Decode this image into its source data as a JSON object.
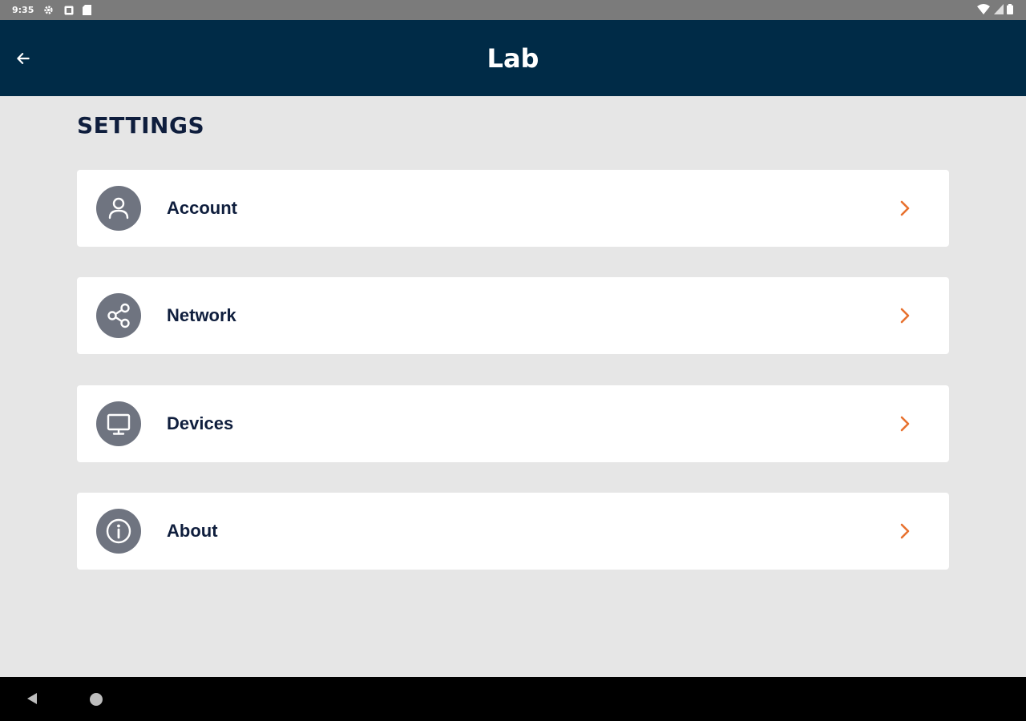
{
  "status_bar": {
    "time": "9:35",
    "icons": [
      "settings-icon",
      "notification-icon",
      "sd-card-icon"
    ],
    "right_icons": [
      "wifi-icon",
      "signal-icon",
      "battery-icon"
    ]
  },
  "app_bar": {
    "title": "Lab",
    "back_icon": "arrow-left-icon"
  },
  "section": {
    "title": "SETTINGS"
  },
  "settings_items": [
    {
      "label": "Account",
      "icon": "user-icon"
    },
    {
      "label": "Network",
      "icon": "share-icon"
    },
    {
      "label": "Devices",
      "icon": "monitor-icon"
    },
    {
      "label": "About",
      "icon": "info-icon"
    }
  ],
  "colors": {
    "app_bar": "#002b47",
    "background": "#e6e6e6",
    "chevron": "#e8712e",
    "icon_circle": "#6f7480",
    "text": "#0f1e3d"
  },
  "nav_bar": {
    "icons": [
      "back-triangle-icon",
      "home-circle-icon"
    ]
  }
}
